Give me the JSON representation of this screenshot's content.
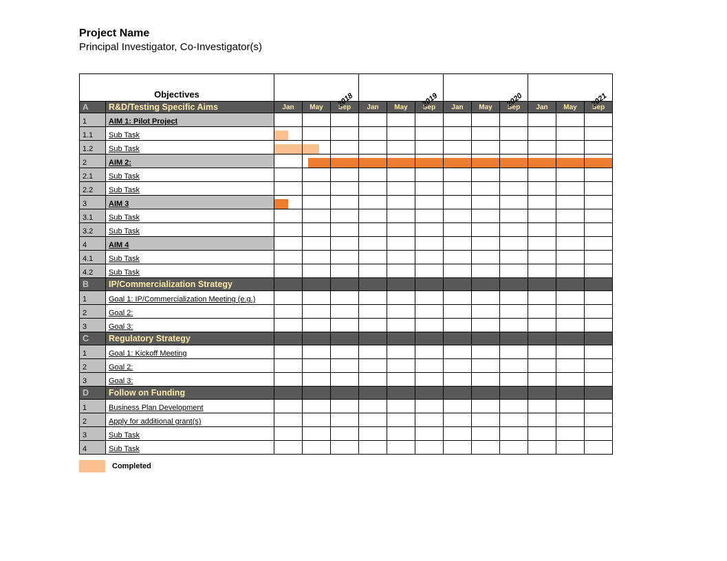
{
  "title": "Project Name",
  "subtitle": "Principal Investigator, Co-Investigator(s)",
  "objectivesHeader": "Objectives",
  "years": [
    "2018",
    "2019",
    "2020",
    "2021"
  ],
  "months": [
    "Jan",
    "May",
    "Sep",
    "Jan",
    "May",
    "Sep",
    "Jan",
    "May",
    "Sep",
    "Jan",
    "May",
    "Sep"
  ],
  "legendLabel": "Completed",
  "sections": [
    {
      "letter": "A",
      "title": "R&D/Testing Specific Aims",
      "showMonthHeader": true,
      "rows": [
        {
          "id": "1",
          "name": "AIM 1: Pilot Project",
          "aim": true
        },
        {
          "id": "1.1",
          "name": "Sub Task",
          "bars": [
            {
              "col": 0,
              "class": "completed",
              "w": 0.5
            }
          ]
        },
        {
          "id": "1.2",
          "name": "Sub Task",
          "bars": [
            {
              "col": 0,
              "class": "completed",
              "w": 1
            },
            {
              "col": 1,
              "class": "completed",
              "w": 0.6
            }
          ]
        },
        {
          "id": "2",
          "name": "AIM 2:",
          "aim": true,
          "bars": [
            {
              "col": 1,
              "class": "planned",
              "w": 1,
              "off": 0.2
            },
            {
              "col": 2,
              "class": "planned",
              "w": 1
            },
            {
              "col": 3,
              "class": "planned",
              "w": 1
            },
            {
              "col": 4,
              "class": "planned",
              "w": 1
            },
            {
              "col": 5,
              "class": "planned",
              "w": 1
            },
            {
              "col": 6,
              "class": "planned",
              "w": 1
            },
            {
              "col": 7,
              "class": "planned",
              "w": 1
            },
            {
              "col": 8,
              "class": "planned",
              "w": 1
            },
            {
              "col": 9,
              "class": "planned",
              "w": 1
            },
            {
              "col": 10,
              "class": "planned",
              "w": 1
            },
            {
              "col": 11,
              "class": "planned",
              "w": 1
            }
          ]
        },
        {
          "id": "2.1",
          "name": "Sub Task"
        },
        {
          "id": "2.2",
          "name": "Sub Task"
        },
        {
          "id": "3",
          "name": "AIM 3",
          "aim": true,
          "bars": [
            {
              "col": 0,
              "class": "planned",
              "w": 0.5
            }
          ]
        },
        {
          "id": "3.1",
          "name": "Sub Task"
        },
        {
          "id": "3.2",
          "name": "Sub Task"
        },
        {
          "id": "4",
          "name": "AIM 4",
          "aim": true
        },
        {
          "id": "4.1",
          "name": "Sub Task"
        },
        {
          "id": "4.2",
          "name": "Sub Task"
        }
      ]
    },
    {
      "letter": "B",
      "title": "IP/Commercialization Strategy",
      "rows": [
        {
          "id": "1",
          "name": "Goal 1: IP/Commercialization Meeting (e.g.)"
        },
        {
          "id": "2",
          "name": "Goal 2:"
        },
        {
          "id": "3",
          "name": "Goal 3:"
        }
      ]
    },
    {
      "letter": "C",
      "title": "Regulatory Strategy",
      "rows": [
        {
          "id": "1",
          "name": "Goal 1: Kickoff Meeting"
        },
        {
          "id": "2",
          "name": "Goal 2:"
        },
        {
          "id": "3",
          "name": "Goal 3:"
        }
      ]
    },
    {
      "letter": "D",
      "title": "Follow on Funding",
      "rows": [
        {
          "id": "1",
          "name": "Business Plan Development"
        },
        {
          "id": "2",
          "name": "Apply for additional grant(s)"
        },
        {
          "id": "3",
          "name": "Sub Task"
        },
        {
          "id": "4",
          "name": "Sub Task"
        }
      ]
    }
  ],
  "chart_data": {
    "type": "gantt",
    "title": "Project Name",
    "time_axis": {
      "unit": "months",
      "start_year": 2018,
      "end_year": 2021,
      "columns": [
        "2018-Jan",
        "2018-May",
        "2018-Sep",
        "2019-Jan",
        "2019-May",
        "2019-Sep",
        "2020-Jan",
        "2020-May",
        "2020-Sep",
        "2021-Jan",
        "2021-May",
        "2021-Sep"
      ]
    },
    "series": [
      {
        "name": "1.1 Sub Task",
        "status": "completed",
        "start": 0,
        "end": 0.5
      },
      {
        "name": "1.2 Sub Task",
        "status": "completed",
        "start": 0,
        "end": 1.6
      },
      {
        "name": "AIM 2:",
        "status": "planned",
        "start": 1.2,
        "end": 12
      },
      {
        "name": "AIM 3",
        "status": "planned",
        "start": 0,
        "end": 0.5
      }
    ],
    "legend": {
      "completed": "#fac090",
      "planned": "#ed7d31"
    }
  }
}
